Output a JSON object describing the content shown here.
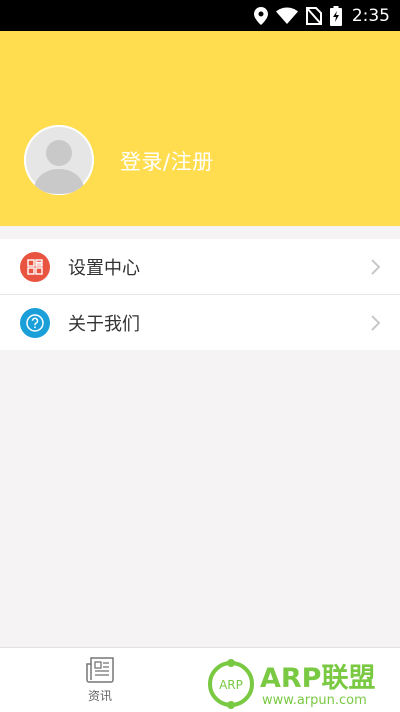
{
  "status_bar": {
    "time": "2:35",
    "icons": [
      "location-icon",
      "wifi-icon",
      "no-sim-icon",
      "battery-charging-icon"
    ]
  },
  "profile": {
    "login_label": "登录/注册",
    "avatar_icon": "default-avatar-icon"
  },
  "menu": {
    "items": [
      {
        "label": "设置中心",
        "icon": "settings-grid-icon",
        "icon_color": "#e8543f"
      },
      {
        "label": "关于我们",
        "icon": "question-icon",
        "icon_color": "#1a9fd9"
      }
    ]
  },
  "bottom_nav": {
    "tabs": [
      {
        "label": "资讯",
        "icon": "newspaper-icon"
      }
    ]
  },
  "watermark": {
    "badge_text": "ARP",
    "brand": "ARP联盟",
    "url": "www.arpun.com"
  },
  "colors": {
    "header_yellow": "#ffdd4f",
    "background": "#f5f3f3",
    "watermark_green": "#7ac943"
  }
}
